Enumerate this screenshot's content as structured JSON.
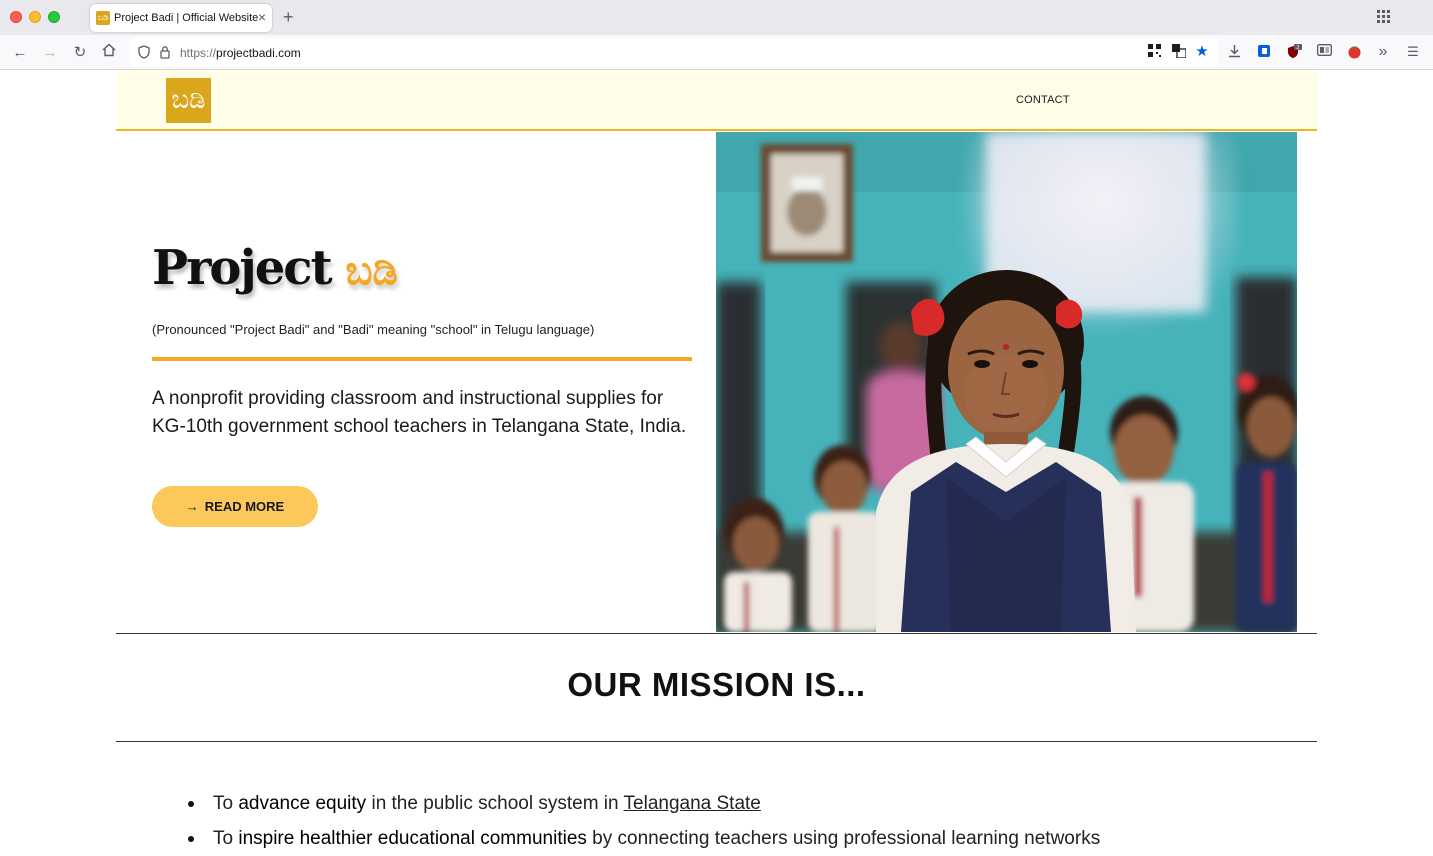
{
  "browser": {
    "tab_title": "Project Badi | Official Website",
    "tab_favicon_text": "ಬಡಿ",
    "new_tab_label": "+",
    "close_tab_label": "×",
    "url_protocol": "https://",
    "url_host": "projectbadi.com",
    "toolbar_icons": [
      "qr-code-icon",
      "translate-icon",
      "bookmark-star-icon",
      "download-icon",
      "container-icon",
      "ublock-icon",
      "reader-view-icon",
      "tomato-icon",
      "overflow-icon",
      "hamburger-menu-icon"
    ],
    "ublock_badge": "2"
  },
  "site": {
    "logo_text": "ಬಡಿ",
    "nav": {
      "contact_label": "CONTACT"
    },
    "hero": {
      "title_word": "Project",
      "title_accent": "ಬಡಿ",
      "pronunciation": "(Pronounced \"Project Badi\" and \"Badi\" meaning \"school\" in Telugu language)",
      "description": "A nonprofit providing classroom and instructional supplies for KG-10th government school teachers in Telangana State, India.",
      "button_label": "READ MORE",
      "photo_alt": "Student in school uniform in a classroom"
    },
    "mission": {
      "heading": "OUR MISSION IS...",
      "items": [
        {
          "pre": "To ",
          "bold": "advance equity",
          "mid": " in the public school system in ",
          "link": "Telangana State",
          "post": ""
        },
        {
          "pre": "To ",
          "bold": "inspire healthier educational communities",
          "mid": " by connecting teachers using professional learning networks",
          "link": "",
          "post": ""
        }
      ]
    }
  },
  "colors": {
    "header_bg": "#fffde8",
    "accent_orange": "#f5a623",
    "button_bg": "#fcc85a",
    "logo_bg": "#d9a61c"
  }
}
